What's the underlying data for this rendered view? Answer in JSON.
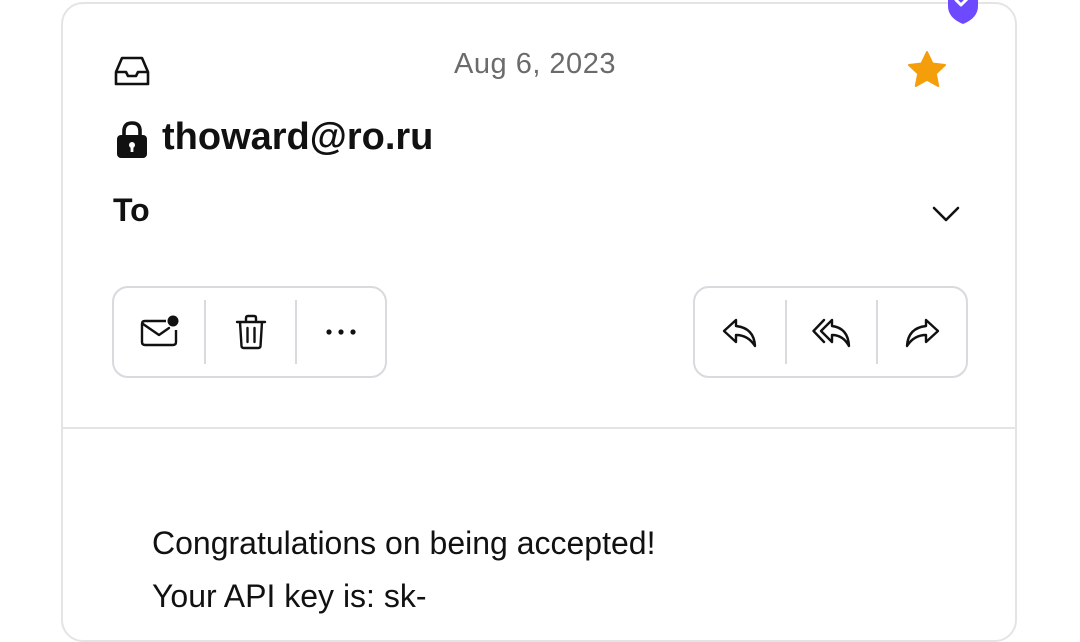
{
  "email": {
    "date": "Aug 6, 2023",
    "sender": "thoward@ro.ru",
    "to_label": "To",
    "body_lines": [
      "Congratulations on being accepted!",
      "Your API key is: sk-"
    ]
  },
  "toolbar": {
    "left": [
      {
        "name": "mark-unread-button",
        "icon": "mail-unread-icon"
      },
      {
        "name": "delete-button",
        "icon": "trash-icon"
      },
      {
        "name": "more-button",
        "icon": "more-icon"
      }
    ],
    "right": [
      {
        "name": "reply-button",
        "icon": "reply-icon"
      },
      {
        "name": "reply-all-button",
        "icon": "reply-all-icon"
      },
      {
        "name": "forward-button",
        "icon": "forward-icon"
      }
    ]
  },
  "icons": {
    "folder": "inbox-icon",
    "starred": "star-icon",
    "encryption": "lock-icon",
    "verified": "shield-check-icon",
    "recipients_toggle": "chevron-down-icon"
  },
  "colors": {
    "star": "#f59e0b",
    "shield": "#6d4aff",
    "border": "#e4e4e7",
    "date_text": "#6b6b6b"
  }
}
